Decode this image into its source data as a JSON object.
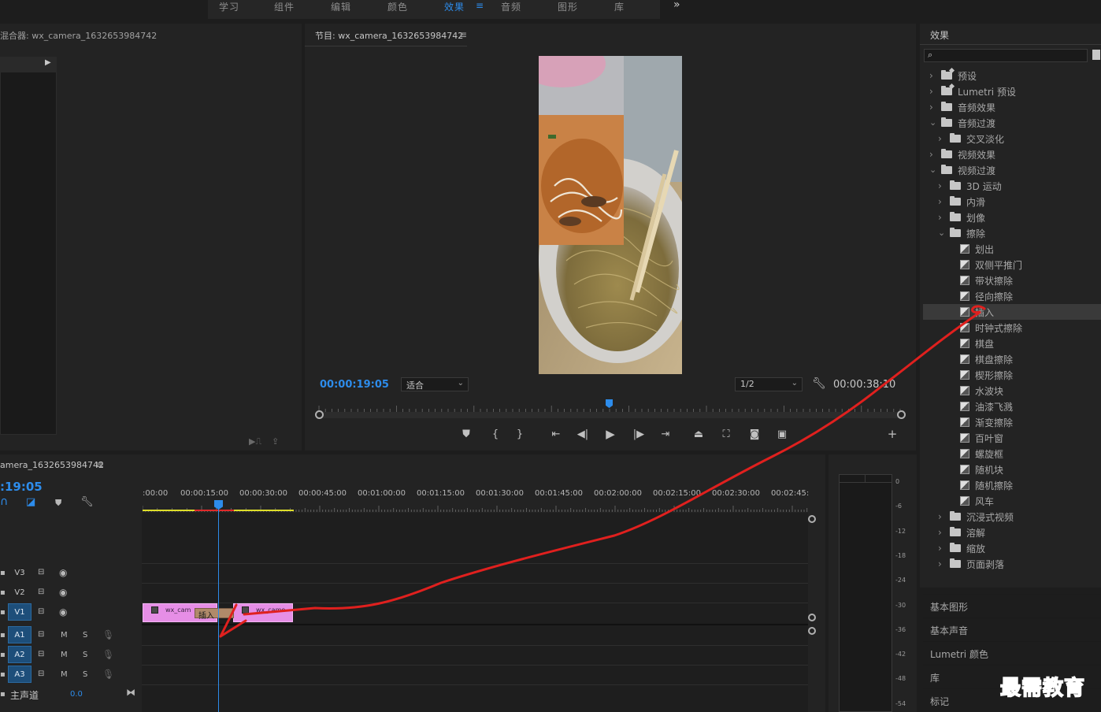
{
  "workspaces": {
    "tabs": [
      {
        "label": "学习"
      },
      {
        "label": "组件"
      },
      {
        "label": "编辑"
      },
      {
        "label": "颜色"
      },
      {
        "label": "效果",
        "active": true
      },
      {
        "label": "音频"
      },
      {
        "label": "图形"
      },
      {
        "label": "库"
      }
    ],
    "more": "»"
  },
  "source_panel": {
    "title": "混合器: wx_camera_1632653984742"
  },
  "program_monitor": {
    "title": "节目: wx_camera_1632653984742",
    "current_time": "00:00:19:05",
    "fit": "适合",
    "resolution": "1/2",
    "duration": "00:00:38:10",
    "playhead_fraction": 0.498
  },
  "timeline": {
    "title": "amera_1632653984742",
    "current_time": ":19:05",
    "ruler_labels": [
      ":00:00",
      "00:00:15:00",
      "00:00:30:00",
      "00:00:45:00",
      "00:01:00:00",
      "00:01:15:00",
      "00:01:30:00",
      "00:01:45:00",
      "00:02:00:00",
      "00:02:15:00",
      "00:02:30:00",
      "00:02:45:"
    ],
    "tracks": [
      {
        "id": "V3",
        "toggles": [
          "",
          ""
        ],
        "active": false
      },
      {
        "id": "V2",
        "toggles": [
          "",
          ""
        ],
        "active": false
      },
      {
        "id": "V1",
        "toggles": [
          "",
          ""
        ],
        "active": true
      },
      {
        "id": "A1",
        "toggles": [
          "M",
          "S"
        ],
        "active": true
      },
      {
        "id": "A2",
        "toggles": [
          "M",
          "S"
        ],
        "active": true
      },
      {
        "id": "A3",
        "toggles": [
          "M",
          "S"
        ],
        "active": true
      }
    ],
    "master": {
      "label": "主声道",
      "value": "0.0"
    },
    "clip_left_label": "wx_cam",
    "clip_right_label": "wx_came",
    "drop_tooltip": "插入"
  },
  "meter": {
    "labels": [
      "0",
      "-6",
      "-12",
      "-18",
      "-24",
      "-30",
      "-36",
      "-42",
      "-48",
      "-54"
    ]
  },
  "effects_panel": {
    "title": "效果",
    "search_placeholder": "",
    "tree": [
      {
        "label": "预设",
        "kind": "preset",
        "depth": 0,
        "state": "closed"
      },
      {
        "label": "Lumetri 预设",
        "kind": "preset",
        "depth": 0,
        "state": "closed"
      },
      {
        "label": "音频效果",
        "kind": "folder",
        "depth": 0,
        "state": "closed"
      },
      {
        "label": "音频过渡",
        "kind": "folder",
        "depth": 0,
        "state": "open"
      },
      {
        "label": "交叉淡化",
        "kind": "folder",
        "depth": 1,
        "state": "closed"
      },
      {
        "label": "视频效果",
        "kind": "folder",
        "depth": 0,
        "state": "closed"
      },
      {
        "label": "视频过渡",
        "kind": "folder",
        "depth": 0,
        "state": "open"
      },
      {
        "label": "3D 运动",
        "kind": "folder",
        "depth": 1,
        "state": "closed"
      },
      {
        "label": "内滑",
        "kind": "folder",
        "depth": 1,
        "state": "closed"
      },
      {
        "label": "划像",
        "kind": "folder",
        "depth": 1,
        "state": "closed"
      },
      {
        "label": "擦除",
        "kind": "folder",
        "depth": 1,
        "state": "open"
      },
      {
        "label": "划出",
        "kind": "effect",
        "depth": 2
      },
      {
        "label": "双侧平推门",
        "kind": "effect",
        "depth": 2
      },
      {
        "label": "带状擦除",
        "kind": "effect",
        "depth": 2
      },
      {
        "label": "径向擦除",
        "kind": "effect",
        "depth": 2
      },
      {
        "label": "插入",
        "kind": "effect",
        "depth": 2,
        "selected": true
      },
      {
        "label": "时钟式擦除",
        "kind": "effect",
        "depth": 2
      },
      {
        "label": "棋盘",
        "kind": "effect",
        "depth": 2
      },
      {
        "label": "棋盘擦除",
        "kind": "effect",
        "depth": 2
      },
      {
        "label": "楔形擦除",
        "kind": "effect",
        "depth": 2
      },
      {
        "label": "水波块",
        "kind": "effect",
        "depth": 2
      },
      {
        "label": "油漆飞溅",
        "kind": "effect",
        "depth": 2
      },
      {
        "label": "渐变擦除",
        "kind": "effect",
        "depth": 2
      },
      {
        "label": "百叶窗",
        "kind": "effect",
        "depth": 2
      },
      {
        "label": "螺旋框",
        "kind": "effect",
        "depth": 2
      },
      {
        "label": "随机块",
        "kind": "effect",
        "depth": 2
      },
      {
        "label": "随机擦除",
        "kind": "effect",
        "depth": 2
      },
      {
        "label": "风车",
        "kind": "effect",
        "depth": 2
      },
      {
        "label": "沉浸式视频",
        "kind": "folder",
        "depth": 1,
        "state": "closed"
      },
      {
        "label": "溶解",
        "kind": "folder",
        "depth": 1,
        "state": "closed"
      },
      {
        "label": "缩放",
        "kind": "folder",
        "depth": 1,
        "state": "closed"
      },
      {
        "label": "页面剥落",
        "kind": "folder",
        "depth": 1,
        "state": "closed"
      }
    ],
    "bottom_panels": [
      "基本图形",
      "基本声音",
      "Lumetri 颜色",
      "库",
      "标记"
    ]
  },
  "watermark": "最需教育",
  "colors": {
    "accent_blue": "#2d8ceb",
    "clip_pink": "#e68ee6",
    "annotation_red": "#e0201e"
  }
}
